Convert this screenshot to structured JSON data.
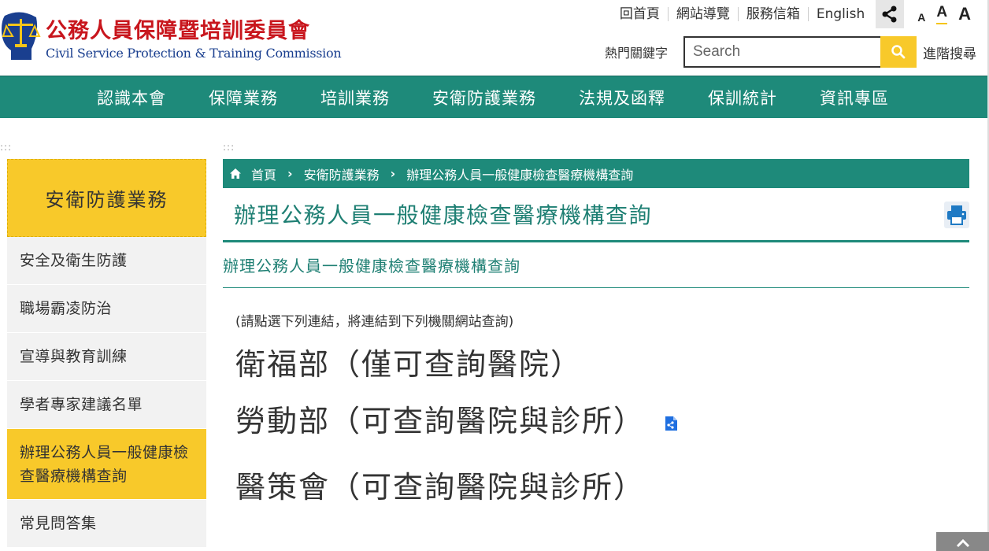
{
  "brand": {
    "name_zh": "公務人員保障暨培訓委員會",
    "name_en": "Civil Service Protection & Training Commission"
  },
  "toplinks": [
    "回首頁",
    "網站導覽",
    "服務信箱",
    "English"
  ],
  "fontsize_labels": [
    "A",
    "A",
    "A"
  ],
  "search": {
    "hot_keywords_label": "熱門關鍵字",
    "placeholder": "Search",
    "advanced_label": "進階搜尋"
  },
  "nav": [
    "認識本會",
    "保障業務",
    "培訓業務",
    "安衛防護業務",
    "法規及函釋",
    "保訓統計",
    "資訊專區"
  ],
  "sidebar": {
    "title": "安衛防護業務",
    "items": [
      "安全及衛生防護",
      "職場霸凌防治",
      "宣導與教育訓練",
      "學者專家建議名單",
      "辦理公務人員一般健康檢查醫療機構查詢",
      "常見問答集"
    ],
    "active_index": 4
  },
  "breadcrumb": [
    "首頁",
    "安衛防護業務",
    "辦理公務人員一般健康檢查醫療機構查詢"
  ],
  "page": {
    "title": "辦理公務人員一般健康檢查醫療機構查詢",
    "subtitle": "辦理公務人員一般健康檢查醫療機構查詢",
    "instruction": "(請點選下列連結，將連結到下列機關網站查詢)",
    "links": [
      "衛福部（僅可查詢醫院）",
      "勞動部（可查詢醫院與診所）",
      "醫策會（可查詢醫院與診所）"
    ]
  },
  "colors": {
    "brand_red": "#c8161d",
    "brand_blue": "#1a3f8f",
    "teal": "#1e8a7a",
    "yellow": "#f8c92a"
  }
}
